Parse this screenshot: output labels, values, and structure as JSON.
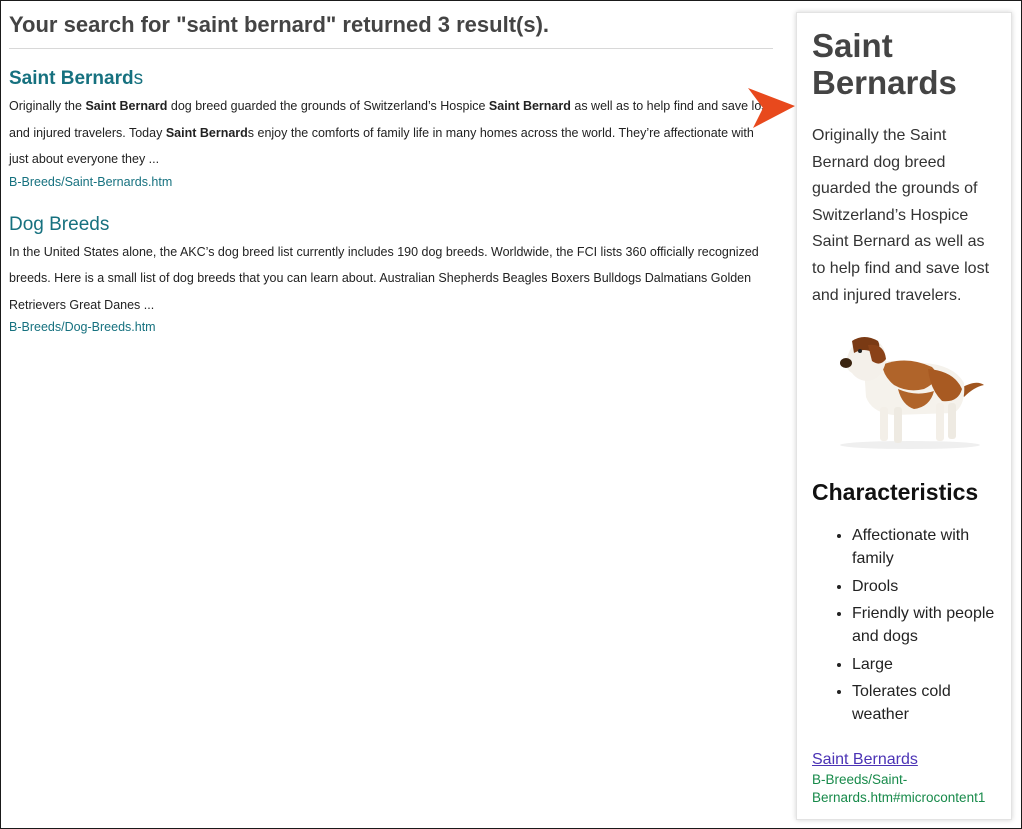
{
  "search": {
    "heading": "Your search for \"saint bernard\" returned 3 result(s)."
  },
  "results": [
    {
      "title_match": "Saint Bernard",
      "title_rest": "s",
      "abstract": [
        {
          "t": "Originally the ",
          "b": false
        },
        {
          "t": "Saint Bernard",
          "b": true
        },
        {
          "t": " dog breed guarded the grounds of Switzerland’s Hospice ",
          "b": false
        },
        {
          "t": "Saint Bernard",
          "b": true
        },
        {
          "t": " as well as to help find and save lost and injured travelers. Today ",
          "b": false
        },
        {
          "t": "Saint Bernard",
          "b": true
        },
        {
          "t": "s enjoy the comforts of family life in many homes across the world. They’re affectionate with just about everyone they ...",
          "b": false
        }
      ],
      "url": "B-Breeds/Saint-Bernards.htm"
    },
    {
      "title_match": "",
      "title_rest": "Dog Breeds",
      "abstract": [
        {
          "t": "In the United States alone, the AKC’s dog breed list currently includes 190 dog breeds. Worldwide, the FCI lists 360 officially recognized breeds. Here is a small list of dog breeds that you can learn about. Australian Shepherds Beagles Boxers Bulldogs Dalmatians Golden Retrievers Great Danes ...",
          "b": false
        }
      ],
      "url": "B-Breeds/Dog-Breeds.htm"
    }
  ],
  "panel": {
    "title": "Saint Bernards",
    "intro": "Originally the Saint Bernard dog breed guarded the grounds of Switzerland’s Hospice Saint Bernard as well as to help find and save lost and injured travelers.",
    "image_icon": "saint-bernard-dog-photo",
    "characteristics_heading": "Characteristics",
    "characteristics": [
      "Affectionate with family",
      "Drools",
      "Friendly with people and dogs",
      "Large",
      "Tolerates cold weather"
    ],
    "link_label": "Saint Bernards",
    "link_url": "B-Breeds/Saint-Bernards.htm#microcontent1"
  },
  "colors": {
    "result_link": "#16717f",
    "panel_link": "#4b33b5",
    "panel_url": "#178a4a",
    "arrow": "#e8491d"
  }
}
